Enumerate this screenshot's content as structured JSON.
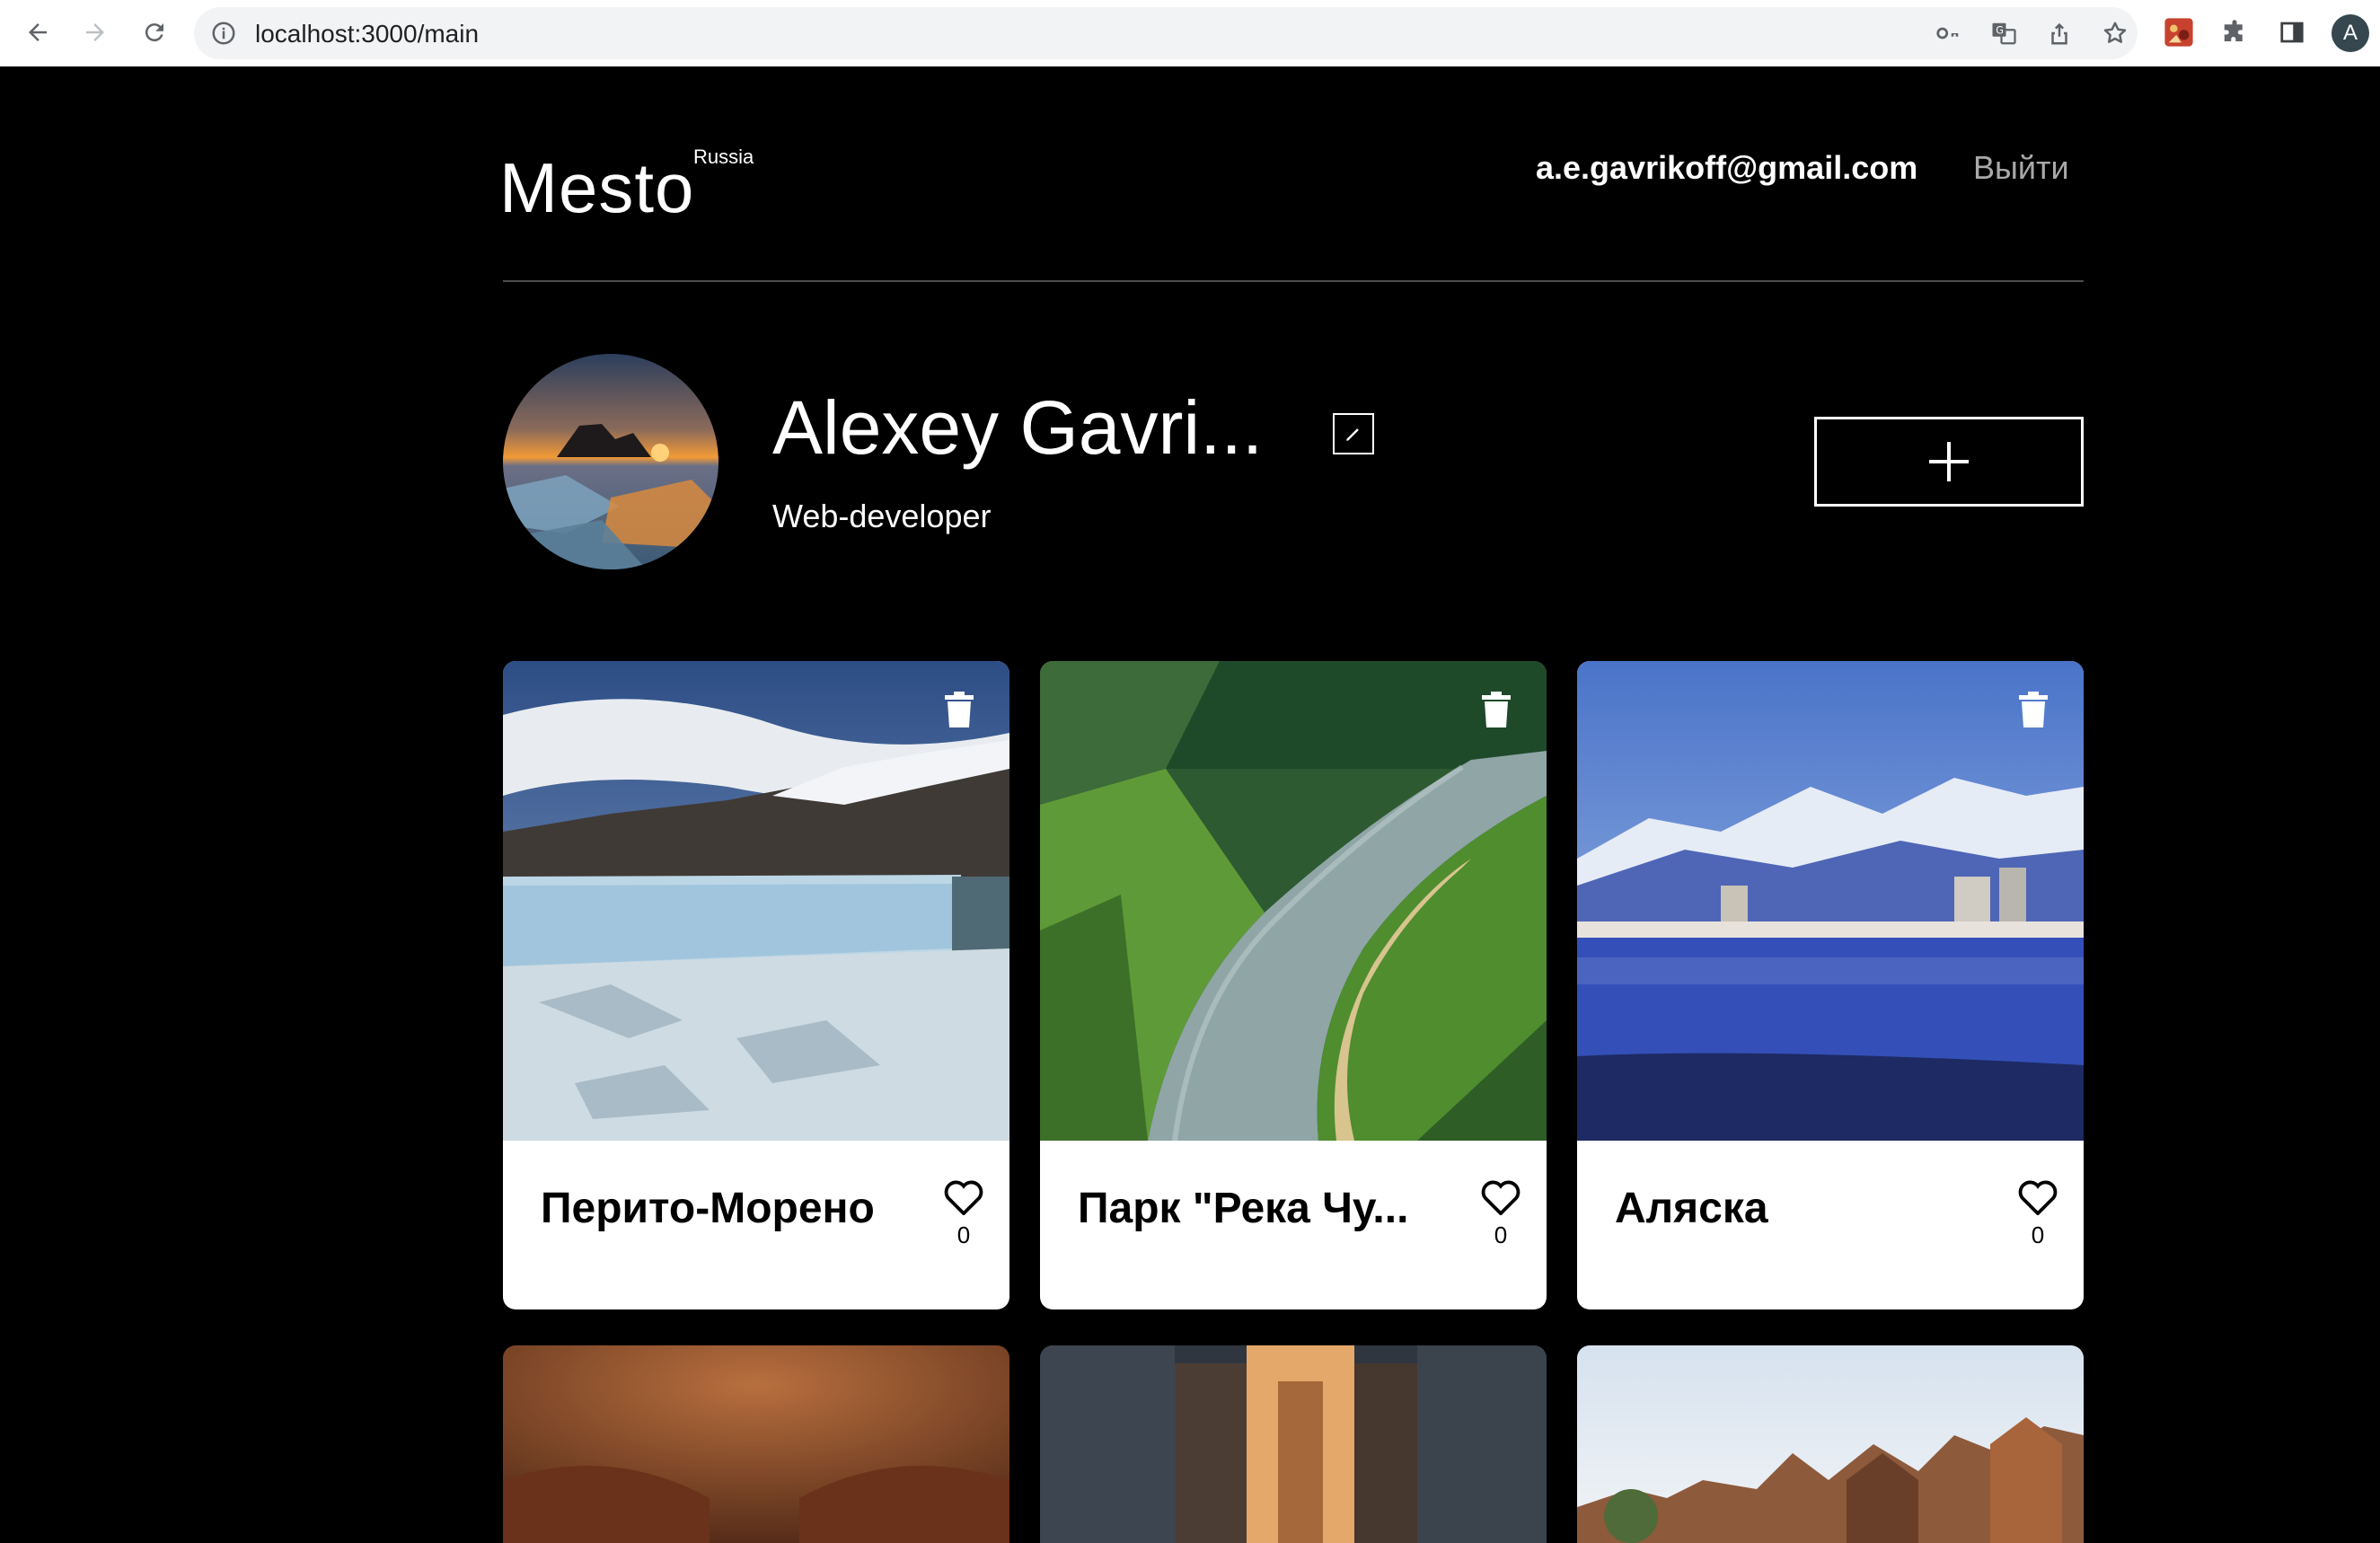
{
  "browser": {
    "url": "localhost:3000/main",
    "profile_initial": "A"
  },
  "header": {
    "logo": "Mesto",
    "logo_sup": "Russia",
    "email": "a.e.gavrikoff@gmail.com",
    "logout": "Выйти"
  },
  "profile": {
    "name": "Alexey Gavri...",
    "about": "Web-developer"
  },
  "cards": [
    {
      "title": "Перито-Морено",
      "likes": "0"
    },
    {
      "title": "Парк \"Река Чу...",
      "likes": "0"
    },
    {
      "title": "Аляска",
      "likes": "0"
    }
  ],
  "icons": {
    "back": "arrow-left-icon",
    "forward": "arrow-right-icon",
    "reload": "reload-icon",
    "info": "info-icon",
    "key": "key-icon",
    "translate": "translate-icon",
    "share": "share-icon",
    "bookmark": "star-icon",
    "extension": "extension-icon",
    "puzzle": "puzzle-icon",
    "sidepanel": "sidepanel-icon",
    "edit": "pencil-icon",
    "add": "plus-icon",
    "delete": "trash-icon",
    "like": "heart-icon"
  }
}
